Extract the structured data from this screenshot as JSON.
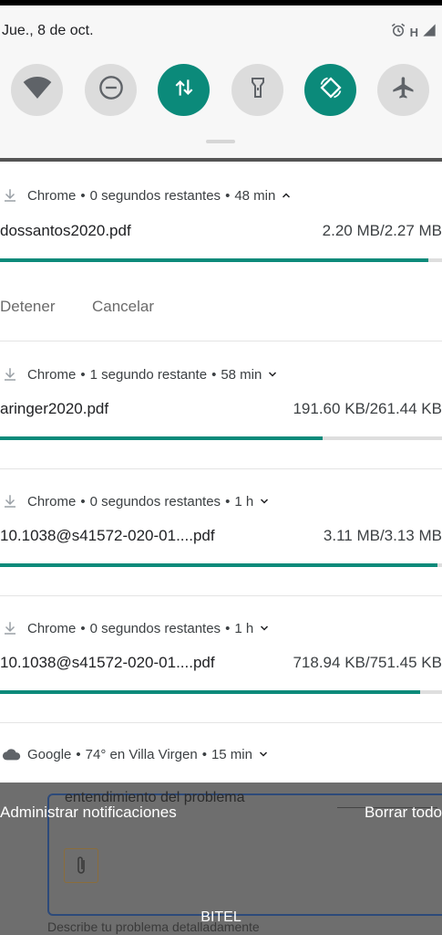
{
  "status": {
    "date": "Jue., 8 de oct.",
    "network": "H"
  },
  "quick_settings": {
    "tiles": [
      {
        "icon": "wifi-icon",
        "active": false
      },
      {
        "icon": "do-not-disturb-icon",
        "active": false
      },
      {
        "icon": "mobile-data-icon",
        "active": true
      },
      {
        "icon": "flashlight-icon",
        "active": false
      },
      {
        "icon": "auto-rotate-icon",
        "active": true
      },
      {
        "icon": "airplane-mode-icon",
        "active": false
      }
    ],
    "active_color": "#0b8a7a",
    "inactive_color": "#dcdcdc"
  },
  "notifications": [
    {
      "app": "Chrome",
      "status": "0 segundos restantes",
      "time": "48 min",
      "file": "dossantos2020.pdf",
      "size": "2.20 MB/2.27 MB",
      "progress": 0.97,
      "expanded": true,
      "actions": [
        "Detener",
        "Cancelar"
      ]
    },
    {
      "app": "Chrome",
      "status": "1 segundo restante",
      "time": "58 min",
      "file": "aringer2020.pdf",
      "size": "191.60 KB/261.44 KB",
      "progress": 0.73,
      "expanded": false
    },
    {
      "app": "Chrome",
      "status": "0 segundos restantes",
      "time": "1 h",
      "file": "10.1038@s41572-020-01....pdf",
      "size": "3.11 MB/3.13 MB",
      "progress": 0.99,
      "expanded": false
    },
    {
      "app": "Chrome",
      "status": "0 segundos restantes",
      "time": "1 h",
      "file": "10.1038@s41572-020-01....pdf",
      "size": "718.94 KB/751.45 KB",
      "progress": 0.95,
      "expanded": false
    },
    {
      "app": "Google",
      "status": "74° en Villa Virgen",
      "time": "15 min",
      "expanded": false
    }
  ],
  "footer": {
    "manage": "Administrar notificaciones",
    "clear_all": "Borrar todo",
    "carrier": "BITEL"
  },
  "background": {
    "text": "entendimiento del problema",
    "bottom_text": "Describe tu problema detalladamente"
  }
}
